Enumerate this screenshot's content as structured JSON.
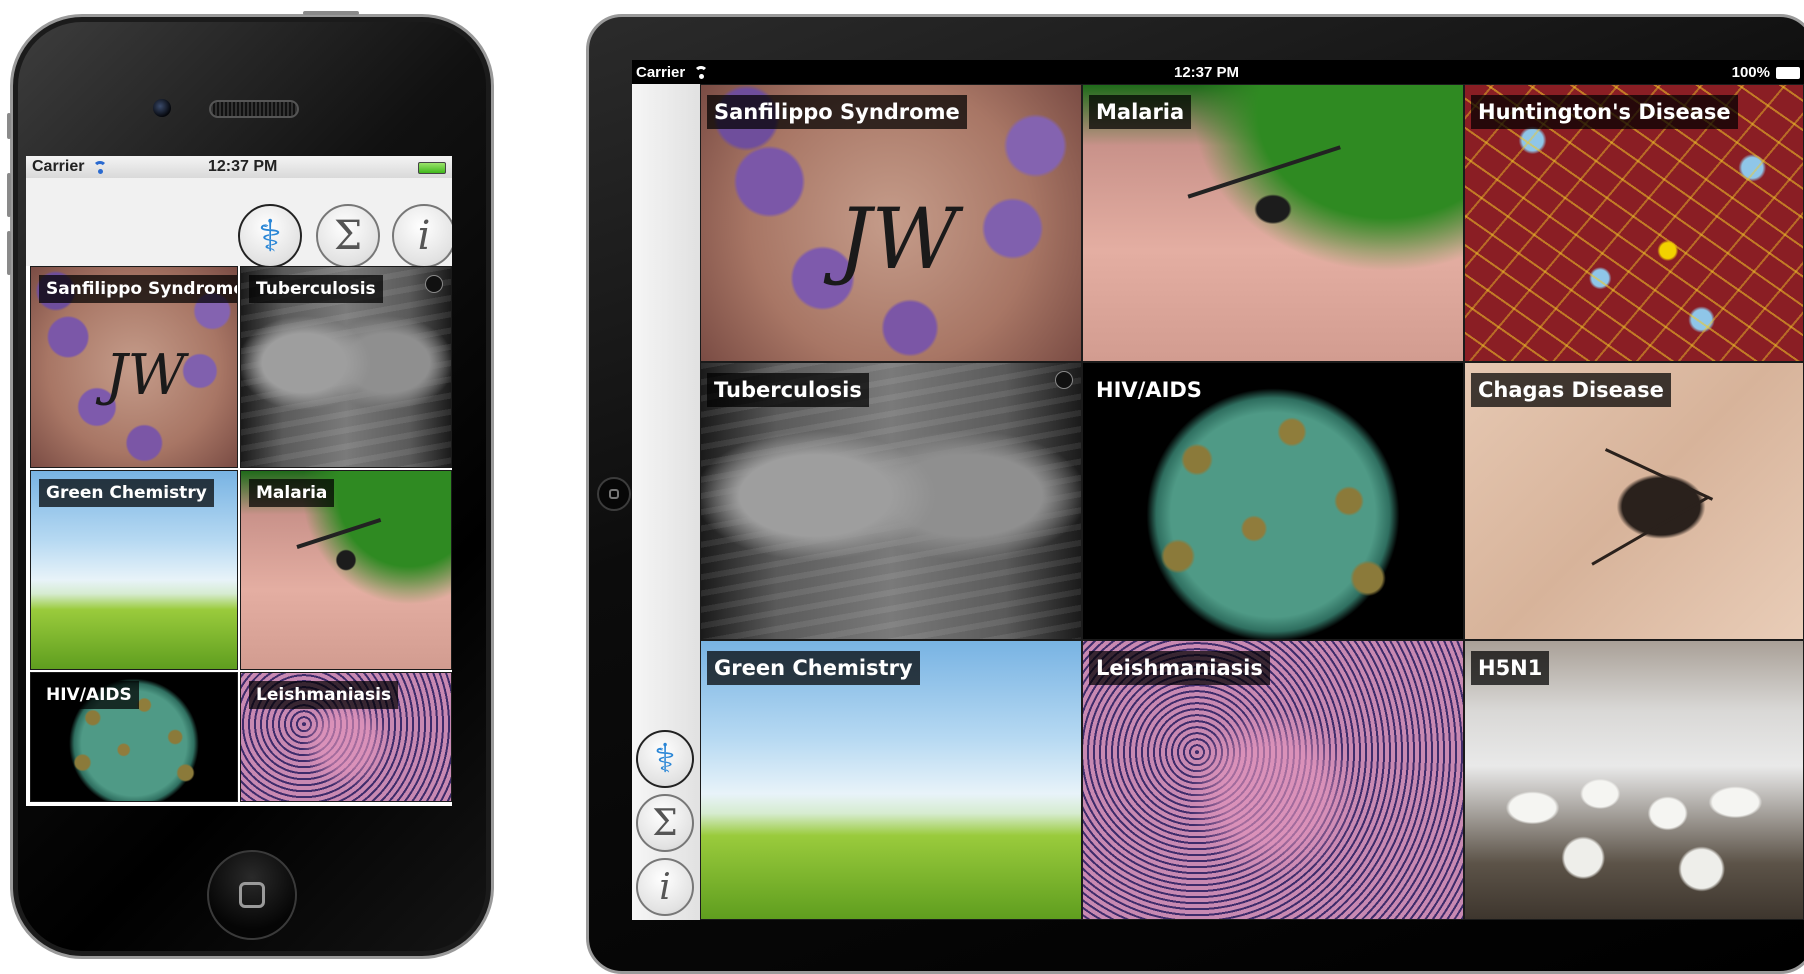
{
  "phone": {
    "status": {
      "carrier": "Carrier",
      "time": "12:37 PM"
    },
    "toolbar": {
      "icons": [
        "medical-caduceus-icon",
        "sigma-icon",
        "info-icon"
      ],
      "sigma": "Σ",
      "info": "i",
      "caduceus": "⚕"
    },
    "tiles": [
      {
        "label": "Sanfilippo Syndrome"
      },
      {
        "label": "Tuberculosis"
      },
      {
        "label": "Green Chemistry"
      },
      {
        "label": "Malaria"
      },
      {
        "label": "HIV/AIDS"
      },
      {
        "label": "Leishmaniasis"
      }
    ]
  },
  "tablet": {
    "status": {
      "carrier": "Carrier",
      "time": "12:37 PM",
      "battery": "100%"
    },
    "sidebar": {
      "icons": [
        "medical-caduceus-icon",
        "sigma-icon",
        "info-icon"
      ],
      "sigma": "Σ",
      "info": "i",
      "caduceus": "⚕"
    },
    "tiles": [
      {
        "label": "Sanfilippo Syndrome"
      },
      {
        "label": "Malaria"
      },
      {
        "label": "Huntington's Disease"
      },
      {
        "label": "Tuberculosis"
      },
      {
        "label": "HIV/AIDS"
      },
      {
        "label": "Chagas Disease"
      },
      {
        "label": "Green Chemistry"
      },
      {
        "label": "Leishmaniasis"
      },
      {
        "label": "H5N1"
      }
    ],
    "tattoo_text": "JW"
  },
  "colors": {
    "accent": "#2a6ad0",
    "label_bg": "#000000"
  }
}
